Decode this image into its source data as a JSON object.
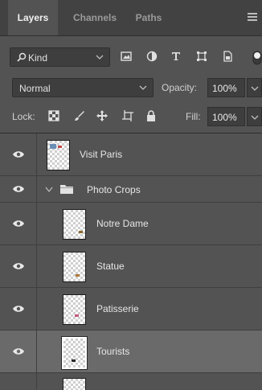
{
  "tabs": [
    {
      "label": "Layers",
      "active": true
    },
    {
      "label": "Channels",
      "active": false
    },
    {
      "label": "Paths",
      "active": false
    }
  ],
  "filter": {
    "kind_label": "Kind",
    "icons": [
      "image-filter-icon",
      "adjustment-filter-icon",
      "type-filter-icon",
      "shape-filter-icon",
      "smart-object-filter-icon"
    ]
  },
  "blend": {
    "mode": "Normal",
    "opacity_label": "Opacity:",
    "opacity_value": "100%"
  },
  "lock": {
    "label": "Lock:",
    "fill_label": "Fill:",
    "fill_value": "100%",
    "icons": [
      "lock-transparent-pixels-icon",
      "lock-image-pixels-icon",
      "lock-position-icon",
      "lock-artboard-icon",
      "lock-all-icon"
    ]
  },
  "layers": [
    {
      "name": "Visit Paris",
      "type": "layer",
      "selected": false
    },
    {
      "name": "Photo Crops",
      "type": "group",
      "expanded": true
    },
    {
      "name": "Notre Dame",
      "type": "layer",
      "selected": false
    },
    {
      "name": "Statue",
      "type": "layer",
      "selected": false
    },
    {
      "name": "Patisserie",
      "type": "layer",
      "selected": false
    },
    {
      "name": "Tourists",
      "type": "layer",
      "selected": true
    }
  ],
  "colors": {
    "panel_bg": "#535353",
    "tab_bar_bg": "#424242",
    "selected_row": "#6a6a6a",
    "field_bg": "#3e3e3e"
  }
}
